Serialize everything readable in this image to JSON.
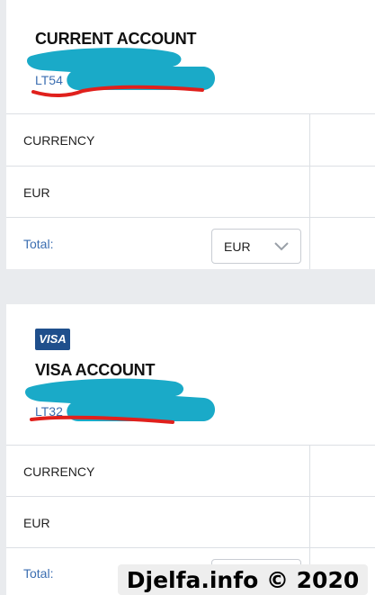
{
  "accounts": [
    {
      "title": "CURRENT ACCOUNT",
      "iban_prefix": "LT54",
      "currency_header": "CURRENCY",
      "currency_value": "EUR",
      "total_label": "Total:",
      "total_currency_selected": "EUR"
    },
    {
      "logo_text": "VISA",
      "title": "VISA ACCOUNT",
      "iban_prefix": "LT32",
      "currency_header": "CURRENCY",
      "currency_value": "EUR",
      "total_label": "Total:"
    }
  ],
  "watermark": "Djelfa.info © 2020",
  "colors": {
    "link_blue": "#3b6eb1",
    "redaction_cyan": "#1aaac8",
    "underline_red": "#e0201c",
    "visa_blue": "#1f4f8c",
    "divider": "#dcdfe4"
  }
}
